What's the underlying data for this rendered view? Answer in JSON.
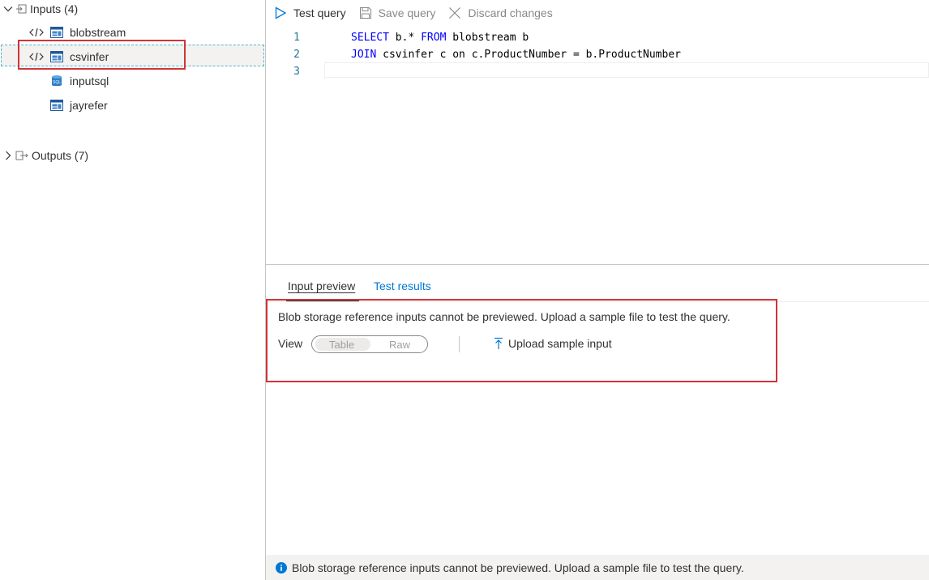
{
  "tree": {
    "inputs": {
      "label": "Inputs (4)",
      "expanded": true,
      "items": [
        {
          "name": "blobstream",
          "icon": "code-icon + stream-input-icon"
        },
        {
          "name": "csvinfer",
          "icon": "code-icon + reference-input-icon",
          "selected": true
        },
        {
          "name": "inputsql",
          "icon": "sql-database-icon"
        },
        {
          "name": "jayrefer",
          "icon": "reference-input-icon"
        }
      ]
    },
    "outputs": {
      "label": "Outputs (7)",
      "expanded": false
    }
  },
  "toolbar": {
    "test_query": "Test query",
    "save_query": "Save query",
    "discard_changes": "Discard changes"
  },
  "editor": {
    "lines": [
      {
        "no": "1",
        "kw1": "SELECT",
        "t1": " b.* ",
        "kw2": "FROM",
        "t2": " blobstream b"
      },
      {
        "no": "2",
        "kw1": "JOIN",
        "t1": " csvinfer c on c.ProductNumber = b.ProductNumber",
        "kw2": "",
        "t2": ""
      },
      {
        "no": "3",
        "kw1": "",
        "t1": "",
        "kw2": "",
        "t2": ""
      }
    ]
  },
  "tabs": {
    "input_preview": "Input preview",
    "test_results": "Test results",
    "active": "input_preview"
  },
  "preview": {
    "message": "Blob storage reference inputs cannot be previewed. Upload a sample file to test the query.",
    "view_label": "View",
    "view_options": [
      "Table",
      "Raw"
    ],
    "upload_label": "Upload sample input"
  },
  "status": {
    "message": "Blob storage reference inputs cannot be previewed. Upload a sample file to test the query."
  },
  "colors": {
    "highlight": "#d13438",
    "accent": "#0078d4",
    "keyword": "#0000ff",
    "line_number": "#237893"
  }
}
